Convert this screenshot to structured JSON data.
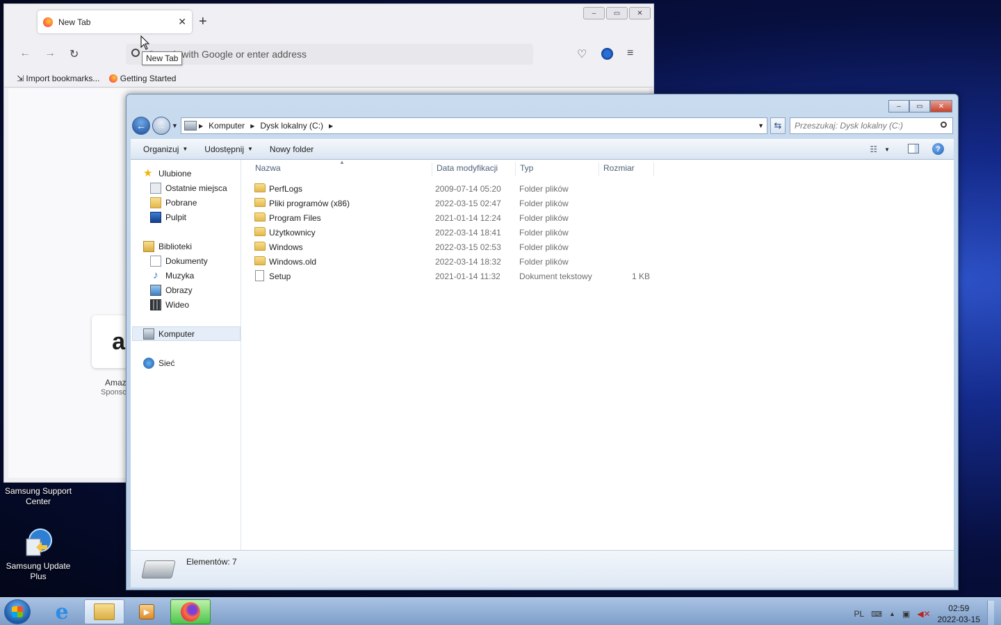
{
  "desktop": {
    "icons": [
      {
        "label": "Samsung Support Center"
      },
      {
        "label": "Samsung Update Plus"
      }
    ]
  },
  "firefox": {
    "tab_title": "New Tab",
    "tab_close": "✕",
    "new_tab_symbol": "+",
    "url_placeholder": "Search with Google or enter address",
    "tooltip": "New Tab",
    "bookmarks": [
      "Import bookmarks...",
      "Getting Started"
    ],
    "behind_tile_text_1": "Amaz",
    "behind_tile_text_2": "Sponso"
  },
  "explorer": {
    "breadcrumbs": [
      "Komputer",
      "Dysk lokalny (C:)"
    ],
    "search_placeholder": "Przeszukaj: Dysk lokalny (C:)",
    "toolbar": {
      "organize": "Organizuj",
      "share": "Udostępnij",
      "new_folder": "Nowy folder"
    },
    "nav": {
      "favorites": "Ulubione",
      "recent": "Ostatnie miejsca",
      "downloads": "Pobrane",
      "desktop": "Pulpit",
      "libraries": "Biblioteki",
      "documents": "Dokumenty",
      "music": "Muzyka",
      "pictures": "Obrazy",
      "videos": "Wideo",
      "computer": "Komputer",
      "network": "Sieć"
    },
    "columns": {
      "name": "Nazwa",
      "date": "Data modyfikacji",
      "type": "Typ",
      "size": "Rozmiar"
    },
    "files": [
      {
        "name": "PerfLogs",
        "date": "2009-07-14 05:20",
        "type": "Folder plików",
        "size": "",
        "kind": "folder"
      },
      {
        "name": "Pliki programów (x86)",
        "date": "2022-03-15 02:47",
        "type": "Folder plików",
        "size": "",
        "kind": "folder"
      },
      {
        "name": "Program Files",
        "date": "2021-01-14 12:24",
        "type": "Folder plików",
        "size": "",
        "kind": "folder"
      },
      {
        "name": "Użytkownicy",
        "date": "2022-03-14 18:41",
        "type": "Folder plików",
        "size": "",
        "kind": "folder"
      },
      {
        "name": "Windows",
        "date": "2022-03-15 02:53",
        "type": "Folder plików",
        "size": "",
        "kind": "folder"
      },
      {
        "name": "Windows.old",
        "date": "2022-03-14 18:32",
        "type": "Folder plików",
        "size": "",
        "kind": "folder"
      },
      {
        "name": "Setup",
        "date": "2021-01-14 11:32",
        "type": "Dokument tekstowy",
        "size": "1 KB",
        "kind": "document"
      }
    ],
    "status": "Elementów: 7"
  },
  "taskbar": {
    "language": "PL",
    "time": "02:59",
    "date": "2022-03-15"
  }
}
